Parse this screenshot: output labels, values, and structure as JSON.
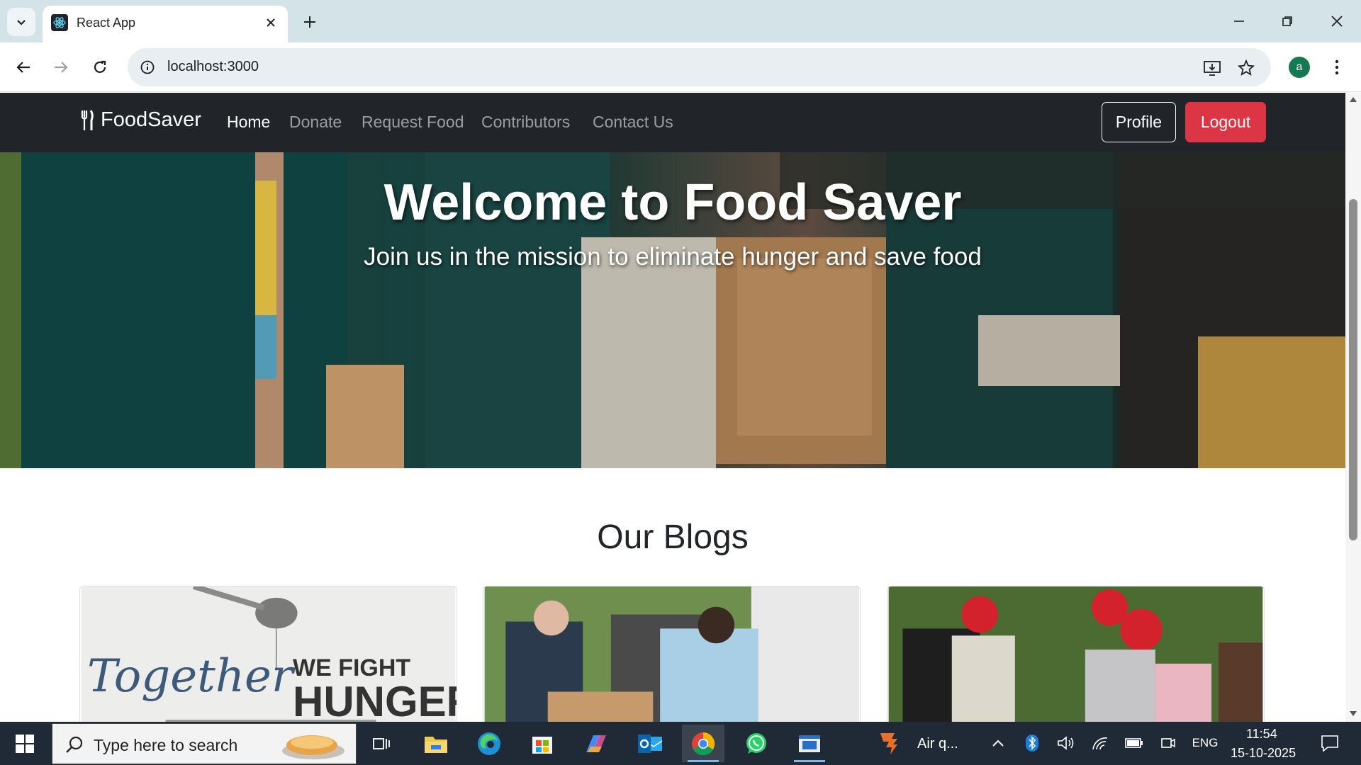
{
  "browser": {
    "tab_title": "React App",
    "url": "localhost:3000",
    "profile_initial": "a"
  },
  "site": {
    "brand": "FoodSaver",
    "nav": [
      "Home",
      "Donate",
      "Request Food",
      "Contributors",
      "Contact Us"
    ],
    "profile_button": "Profile",
    "logout_button": "Logout"
  },
  "hero": {
    "title": "Welcome to Food Saver",
    "subtitle": "Join us in the mission to eliminate hunger and save food"
  },
  "blogs": {
    "heading": "Our Blogs",
    "card1_text_line1": "Together",
    "card1_text_line2": "WE FIGHT",
    "card1_text_line3": "HUNGER"
  },
  "taskbar": {
    "search_placeholder": "Type here to search",
    "weather_app": "Air q...",
    "language": "ENG",
    "time": "11:54",
    "date": "15-10-2025"
  },
  "colors": {
    "tabbar": "#d3e3e8",
    "site_nav": "#212529",
    "logout": "#dc3545",
    "taskbar": "#1f2a36"
  }
}
